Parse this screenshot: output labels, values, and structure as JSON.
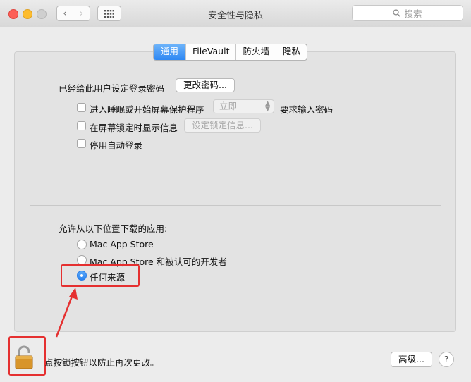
{
  "window": {
    "title": "安全性与隐私"
  },
  "toolbar": {
    "back_glyph": "‹",
    "forward_glyph": "›",
    "search_placeholder": "搜索"
  },
  "tabs": [
    {
      "label": "通用",
      "active": true
    },
    {
      "label": "FileVault",
      "active": false
    },
    {
      "label": "防火墙",
      "active": false
    },
    {
      "label": "隐私",
      "active": false
    }
  ],
  "general": {
    "password_label": "已经给此用户设定登录密码",
    "change_password_button": "更改密码...",
    "require_password_checkbox": "进入睡眠或开始屏幕保护程序",
    "require_password_select": "立即",
    "require_password_suffix": "要求输入密码",
    "lock_message_checkbox": "在屏幕锁定时显示信息",
    "set_lock_message_button": "设定锁定信息...",
    "disable_autologin_checkbox": "停用自动登录"
  },
  "downloads": {
    "heading": "允许从以下位置下载的应用:",
    "options": [
      {
        "label": "Mac App Store",
        "selected": false
      },
      {
        "label": "Mac App Store 和被认可的开发者",
        "selected": false
      },
      {
        "label": "任何来源",
        "selected": true
      }
    ]
  },
  "footer": {
    "lock_text": "点按锁按钮以防止再次更改。",
    "advanced_button": "高级...",
    "help_glyph": "?"
  },
  "colors": {
    "accent": "#2f88f3",
    "annotation": "#e53030"
  },
  "icons": [
    "search-icon",
    "lock-icon",
    "grid-icon"
  ]
}
